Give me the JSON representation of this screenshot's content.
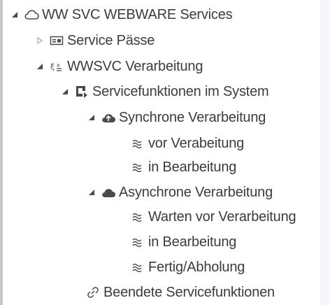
{
  "tree": {
    "root": {
      "label": "WW SVC WEBWARE Services",
      "icon": "cloud-outline-icon",
      "expanded": true
    },
    "service_paesse": {
      "label": "Service Pässe",
      "icon": "id-card-icon",
      "expanded": false
    },
    "wwsvc_verarbeitung": {
      "label": "WWSVC Verarbeitung",
      "icon": "process-icon",
      "expanded": true
    },
    "servicefunktionen": {
      "label": "Servicefunktionen im System",
      "icon": "export-box-icon",
      "expanded": true
    },
    "synchrone": {
      "label": "Synchrone Verarbeitung",
      "icon": "cloud-upload-icon",
      "expanded": true
    },
    "sync_vor": {
      "label": "vor Verabeitung",
      "icon": "wave-icon"
    },
    "sync_in": {
      "label": "in Bearbeitung",
      "icon": "wave-icon"
    },
    "asynchrone": {
      "label": "Asynchrone Verarbeitung",
      "icon": "cloud-filled-icon",
      "expanded": true
    },
    "async_warten": {
      "label": "Warten vor Verarbeitung",
      "icon": "wave-icon"
    },
    "async_in": {
      "label": "in Bearbeitung",
      "icon": "wave-icon"
    },
    "async_fertig": {
      "label": "Fertig/Abholung",
      "icon": "wave-icon"
    },
    "beendete": {
      "label": "Beendete Servicefunktionen",
      "icon": "link-icon"
    }
  },
  "colors": {
    "text": "#3c3c3c",
    "icon": "#4a4a4a",
    "collapsed_toggle": "#a8a8a8"
  }
}
